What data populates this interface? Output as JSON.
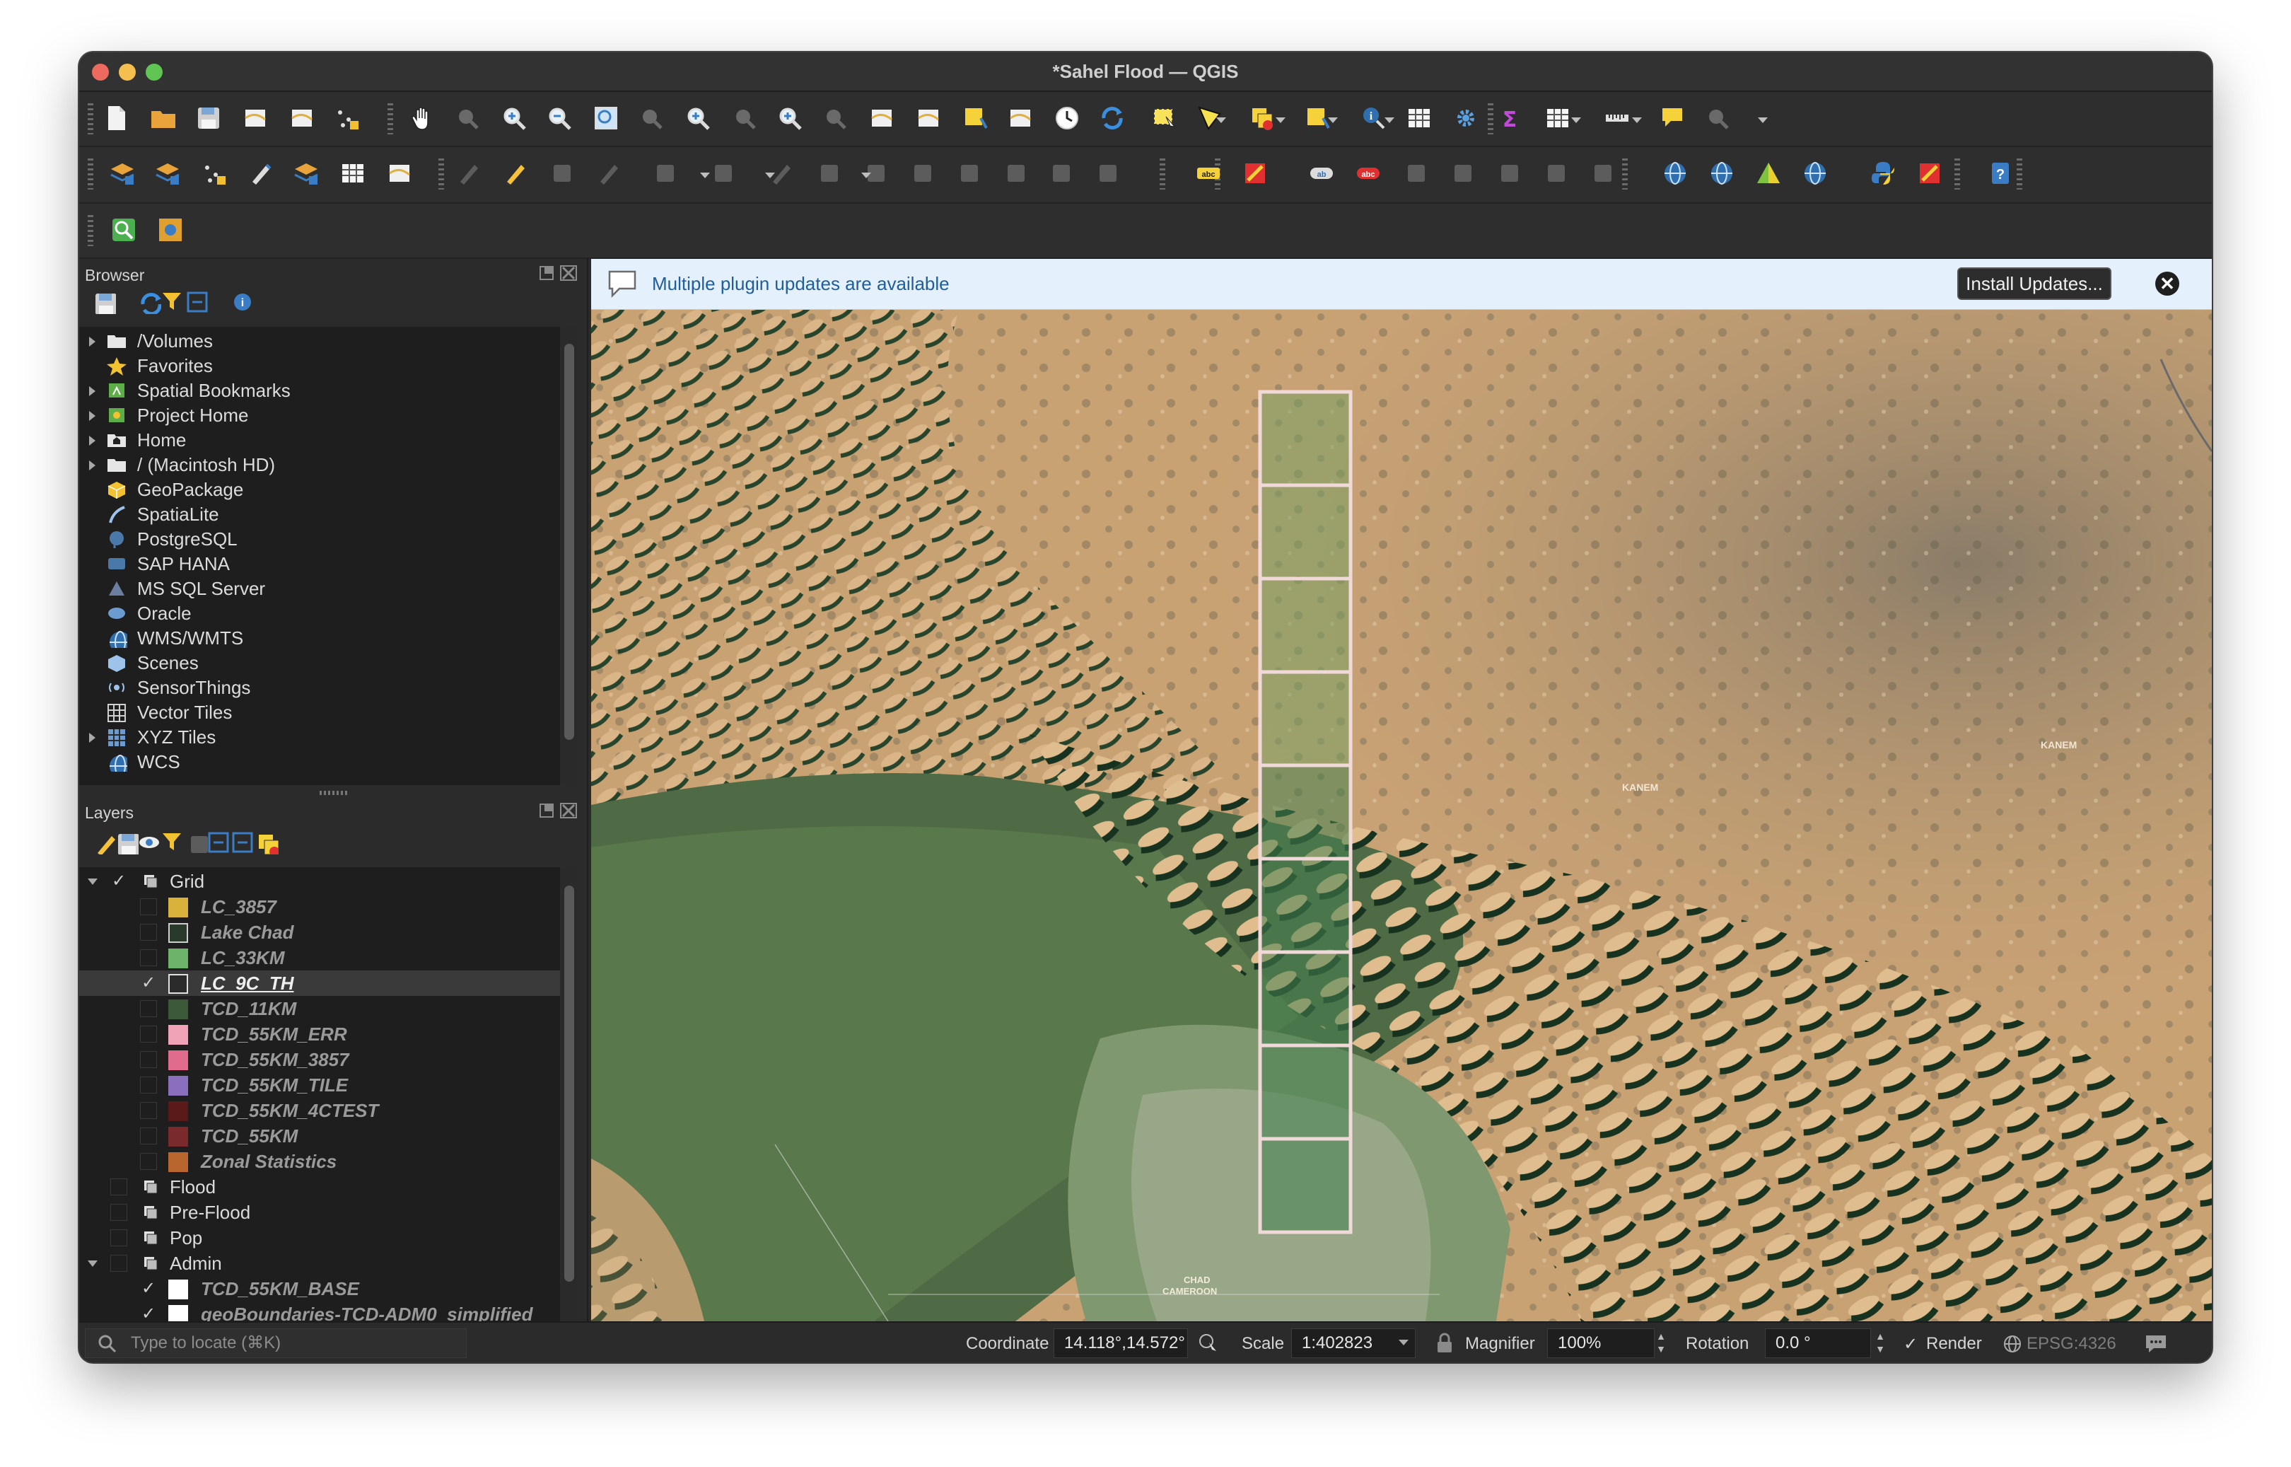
{
  "window": {
    "title": "*Sahel Flood — QGIS"
  },
  "panels": {
    "browser_title": "Browser",
    "layers_title": "Layers"
  },
  "browser": {
    "items": [
      {
        "label": "/Volumes",
        "icon": "folder-icon",
        "expandable": true
      },
      {
        "label": "Favorites",
        "icon": "star-icon",
        "expandable": false
      },
      {
        "label": "Spatial Bookmarks",
        "icon": "bookmark-icon",
        "expandable": true
      },
      {
        "label": "Project Home",
        "icon": "project-home-icon",
        "expandable": true
      },
      {
        "label": "Home",
        "icon": "home-folder-icon",
        "expandable": true
      },
      {
        "label": "/ (Macintosh HD)",
        "icon": "folder-icon",
        "expandable": true
      },
      {
        "label": "GeoPackage",
        "icon": "geopackage-icon",
        "expandable": false
      },
      {
        "label": "SpatiaLite",
        "icon": "spatialite-icon",
        "expandable": false
      },
      {
        "label": "PostgreSQL",
        "icon": "postgresql-icon",
        "expandable": false
      },
      {
        "label": "SAP HANA",
        "icon": "sap-hana-icon",
        "expandable": false
      },
      {
        "label": "MS SQL Server",
        "icon": "mssql-icon",
        "expandable": false
      },
      {
        "label": "Oracle",
        "icon": "oracle-icon",
        "expandable": false
      },
      {
        "label": "WMS/WMTS",
        "icon": "globe-icon",
        "expandable": false
      },
      {
        "label": "Scenes",
        "icon": "scenes-icon",
        "expandable": false
      },
      {
        "label": "SensorThings",
        "icon": "sensorthings-icon",
        "expandable": false
      },
      {
        "label": "Vector Tiles",
        "icon": "vector-tiles-icon",
        "expandable": false
      },
      {
        "label": "XYZ Tiles",
        "icon": "xyz-tiles-icon",
        "expandable": true
      },
      {
        "label": "WCS",
        "icon": "wcs-icon",
        "expandable": false
      }
    ]
  },
  "layers": {
    "items": [
      {
        "label": "Grid",
        "kind": "group",
        "checked": true,
        "expanded": true,
        "indent": 0
      },
      {
        "label": "LC_3857",
        "kind": "layer",
        "checked": false,
        "swatch": "#d8b23a",
        "indent": 1
      },
      {
        "label": "Lake Chad",
        "kind": "layer",
        "checked": false,
        "swatch": "#2a3a2a",
        "swatch_border": "#cfcfcf",
        "indent": 1
      },
      {
        "label": "LC_33KM",
        "kind": "layer",
        "checked": false,
        "swatch": "#6db36a",
        "indent": 1
      },
      {
        "label": "LC_9C_TH",
        "kind": "layer",
        "checked": true,
        "swatch": "#2b2b2b",
        "swatch_border": "#e0e0e0",
        "indent": 1,
        "selected": true
      },
      {
        "label": "TCD_11KM",
        "kind": "layer",
        "checked": false,
        "swatch": "#3c5a3a",
        "indent": 1
      },
      {
        "label": "TCD_55KM_ERR",
        "kind": "layer",
        "checked": false,
        "swatch": "#f0a3b7",
        "indent": 1
      },
      {
        "label": "TCD_55KM_3857",
        "kind": "layer",
        "checked": false,
        "swatch": "#e06b8b",
        "indent": 1
      },
      {
        "label": "TCD_55KM_TILE",
        "kind": "layer",
        "checked": false,
        "swatch": "#8b6fbf",
        "indent": 1
      },
      {
        "label": "TCD_55KM_4CTEST",
        "kind": "layer",
        "checked": false,
        "swatch": "#5a1a1a",
        "indent": 1
      },
      {
        "label": "TCD_55KM",
        "kind": "layer",
        "checked": false,
        "swatch": "#7a2a2a",
        "indent": 1
      },
      {
        "label": "Zonal Statistics",
        "kind": "layer",
        "checked": false,
        "swatch": "#b8652e",
        "indent": 1
      },
      {
        "label": "Flood",
        "kind": "group",
        "checked": false,
        "expanded": false,
        "indent": 0
      },
      {
        "label": "Pre-Flood",
        "kind": "group",
        "checked": false,
        "expanded": false,
        "indent": 0
      },
      {
        "label": "Pop",
        "kind": "group",
        "checked": false,
        "expanded": false,
        "indent": 0
      },
      {
        "label": "Admin",
        "kind": "group",
        "checked": false,
        "expanded": true,
        "indent": 0
      },
      {
        "label": "TCD_55KM_BASE",
        "kind": "layer",
        "checked": true,
        "swatch": "#ffffff",
        "indent": 1
      },
      {
        "label": "geoBoundaries-TCD-ADM0_simplified",
        "kind": "layer",
        "checked": true,
        "swatch": "#ffffff",
        "indent": 1
      }
    ]
  },
  "message_bar": {
    "text": "Multiple plugin updates are available",
    "button": "Install Updates...",
    "close": "✕"
  },
  "map": {
    "labels": {
      "kanem": "KANEM",
      "chad": "CHAD",
      "cameroon": "CAMEROON"
    },
    "grid_tiles": 9
  },
  "status": {
    "locate_placeholder": "Type to locate (⌘K)",
    "coordinate_label": "Coordinate",
    "coordinate_value": "14.118°,14.572°",
    "scale_label": "Scale",
    "scale_value": "1:402823",
    "magnifier_label": "Magnifier",
    "magnifier_value": "100%",
    "rotation_label": "Rotation",
    "rotation_value": "0.0 °",
    "render_label": "Render",
    "render_checked": "✓",
    "crs": "EPSG:4326"
  },
  "colors": {
    "accent": "#1f5e99",
    "selected_row": "#3a3a3a",
    "panel_bg": "#2b2b2b"
  }
}
